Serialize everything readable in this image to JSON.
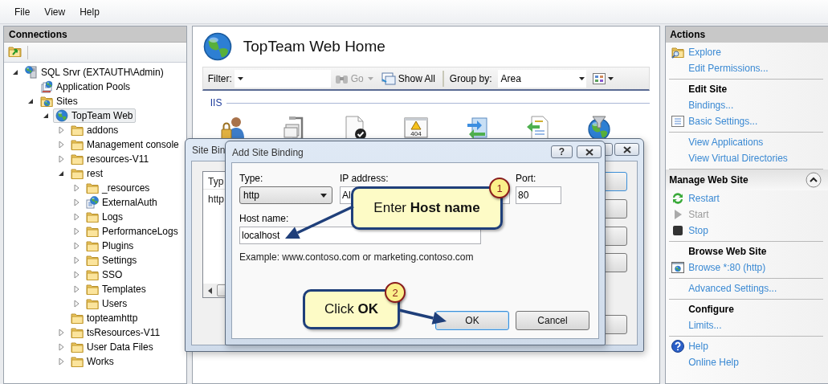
{
  "menu": [
    {
      "label": "File"
    },
    {
      "label": "View"
    },
    {
      "label": "Help"
    }
  ],
  "connections": {
    "title": "Connections",
    "tree": [
      {
        "label": "SQL Srvr (EXTAUTH\\Admin)",
        "kind": "server",
        "expanded": true,
        "selected": false,
        "children": [
          {
            "label": "Application Pools",
            "kind": "pools",
            "selected": false
          },
          {
            "label": "Sites",
            "kind": "sites",
            "expanded": true,
            "selected": false,
            "children": [
              {
                "label": "TopTeam Web",
                "kind": "site",
                "expanded": true,
                "selected": true,
                "children": [
                  {
                    "label": "addons",
                    "kind": "folder",
                    "expanded": false,
                    "selected": false
                  },
                  {
                    "label": "Management console",
                    "kind": "folder",
                    "expanded": false,
                    "selected": false
                  },
                  {
                    "label": "resources-V11",
                    "kind": "folder",
                    "expanded": false,
                    "selected": false
                  },
                  {
                    "label": "rest",
                    "kind": "folder",
                    "expanded": true,
                    "selected": false,
                    "children": [
                      {
                        "label": "_resources",
                        "kind": "folder",
                        "expanded": false,
                        "selected": false
                      },
                      {
                        "label": "ExternalAuth",
                        "kind": "application",
                        "expanded": false,
                        "selected": false
                      },
                      {
                        "label": "Logs",
                        "kind": "folder",
                        "expanded": false,
                        "selected": false
                      },
                      {
                        "label": "PerformanceLogs",
                        "kind": "folder",
                        "expanded": false,
                        "selected": false
                      },
                      {
                        "label": "Plugins",
                        "kind": "folder",
                        "expanded": false,
                        "selected": false
                      },
                      {
                        "label": "Settings",
                        "kind": "folder",
                        "expanded": false,
                        "selected": false
                      },
                      {
                        "label": "SSO",
                        "kind": "folder",
                        "expanded": false,
                        "selected": false
                      },
                      {
                        "label": "Templates",
                        "kind": "folder",
                        "expanded": false,
                        "selected": false
                      },
                      {
                        "label": "Users",
                        "kind": "folder",
                        "expanded": false,
                        "selected": false
                      }
                    ]
                  },
                  {
                    "label": "topteamhttp",
                    "kind": "folder",
                    "selected": false
                  },
                  {
                    "label": "tsResources-V11",
                    "kind": "folder",
                    "expanded": false,
                    "selected": false
                  },
                  {
                    "label": "User Data Files",
                    "kind": "folder",
                    "expanded": false,
                    "selected": false
                  },
                  {
                    "label": "Works",
                    "kind": "folder",
                    "expanded": false,
                    "selected": false
                  }
                ]
              }
            ]
          }
        ]
      }
    ]
  },
  "home": {
    "title": "TopTeam Web Home",
    "filter_label": "Filter:",
    "go": {
      "label": "Go",
      "disabled": true
    },
    "show_all": "Show All",
    "group_by_label": "Group by:",
    "group_by": "Area",
    "group": "IIS",
    "error_page_code": "404"
  },
  "actions": {
    "title": "Actions",
    "groups": [
      {
        "items": [
          {
            "label": "Explore",
            "disabled": false
          },
          {
            "label": "Edit Permissions...",
            "disabled": false
          }
        ]
      },
      {
        "heading": "Edit Site",
        "items": [
          {
            "label": "Bindings...",
            "disabled": false
          },
          {
            "label": "Basic Settings...",
            "disabled": false
          }
        ]
      },
      {
        "items": [
          {
            "label": "View Applications",
            "disabled": false
          },
          {
            "label": "View Virtual Directories",
            "disabled": false
          }
        ]
      },
      {
        "panel": "Manage Web Site",
        "expanded": true,
        "items": [
          {
            "label": "Restart",
            "disabled": false
          },
          {
            "label": "Start",
            "disabled": true
          },
          {
            "label": "Stop",
            "disabled": false
          }
        ]
      },
      {
        "heading": "Browse Web Site",
        "items": [
          {
            "label": "Browse *:80 (http)",
            "disabled": false
          }
        ]
      },
      {
        "items": [
          {
            "label": "Advanced Settings...",
            "disabled": false
          }
        ]
      },
      {
        "heading": "Configure",
        "items": [
          {
            "label": "Limits...",
            "disabled": false
          }
        ]
      },
      {
        "items": [
          {
            "label": "Help",
            "disabled": false
          },
          {
            "label": "Online Help",
            "disabled": false
          }
        ]
      }
    ]
  },
  "site_bindings": {
    "title": "Site Bin",
    "column": "Typ",
    "row": "http"
  },
  "add_site_binding": {
    "title": "Add Site Binding",
    "help_button": "?",
    "type_label": "Type:",
    "type": "http",
    "ip_label": "IP address:",
    "ip": "Al",
    "port_label": "Port:",
    "port": "80",
    "host_label": "Host name:",
    "host": "localhost",
    "example": "Example: www.contoso.com or marketing.contoso.com",
    "buttons": [
      {
        "label": "OK",
        "default": true
      },
      {
        "label": "Cancel",
        "default": false
      }
    ]
  },
  "callouts": [
    {
      "number": "1",
      "text": "Enter **Host name**"
    },
    {
      "number": "2",
      "text": "Click **OK**"
    }
  ]
}
